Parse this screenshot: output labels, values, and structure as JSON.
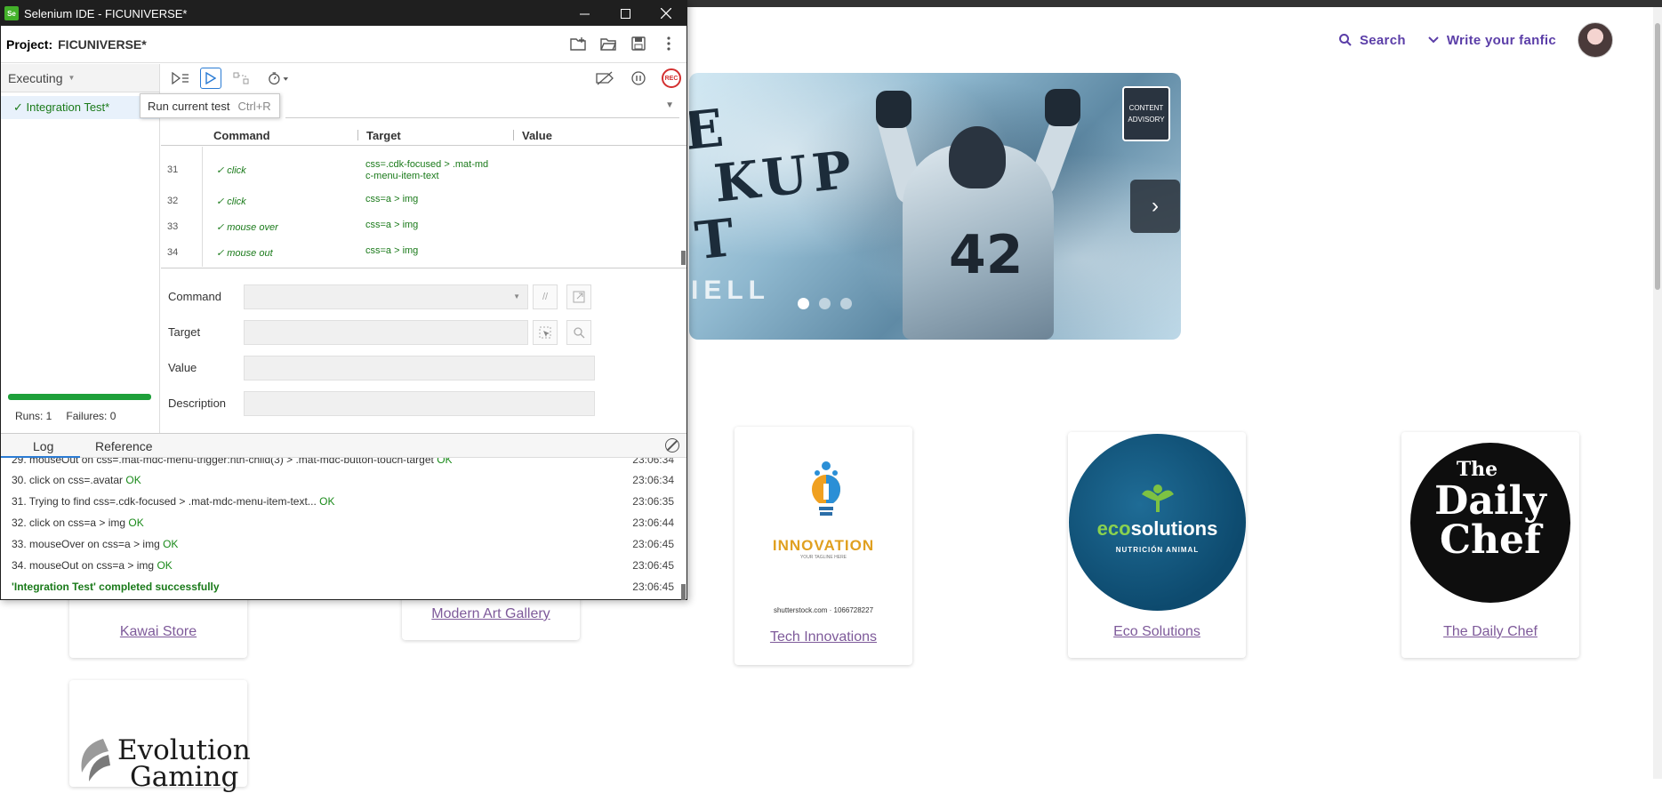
{
  "site": {
    "nav": {
      "search_label": "Search",
      "write_label": "Write your fanfic"
    },
    "carousel": {
      "title_lines": [
        "E",
        "KUP",
        "T"
      ],
      "bottom_text": "IELL",
      "jersey_number": "42",
      "advisory_line1": "CONTENT",
      "advisory_line2": "ADVISORY",
      "next_icon": "chevron-right-icon"
    },
    "cards": [
      {
        "label": "Kawai Store"
      },
      {
        "label": "Modern Art Gallery"
      },
      {
        "label": "Tech Innovations",
        "logo_text": "INNOVATION",
        "logo_tagline": "YOUR TAGLINE HERE",
        "credit": "shutterstock.com · 1066728227"
      },
      {
        "label": "Eco Solutions",
        "logo_text_a": "eco",
        "logo_text_b": "solutions",
        "logo_sub": "NUTRICIÓN ANIMAL"
      },
      {
        "label": "The Daily Chef",
        "logo_line1": "The",
        "logo_line2": "Daily",
        "logo_line3": "Chef"
      },
      {
        "logo_text_1": "Evolution",
        "logo_text_2": "Gaming"
      }
    ]
  },
  "ide": {
    "window_title": "Selenium IDE - FICUNIVERSE*",
    "logo_text": "Se",
    "project_label": "Project:",
    "project_name": "FICUNIVERSE*",
    "executing_label": "Executing",
    "test_name": "✓ Integration Test*",
    "tooltip": {
      "text": "Run current test",
      "shortcut": "Ctrl+R"
    },
    "table_headers": {
      "command": "Command",
      "target": "Target",
      "value": "Value"
    },
    "commands": [
      {
        "num": "31",
        "command": "✓ click",
        "target_l1": "css=.cdk-focused > .mat-md",
        "target_l2": "c-menu-item-text"
      },
      {
        "num": "32",
        "command": "✓ click",
        "target_l1": "css=a > img",
        "target_l2": ""
      },
      {
        "num": "33",
        "command": "✓ mouse over",
        "target_l1": "css=a > img",
        "target_l2": ""
      },
      {
        "num": "34",
        "command": "✓ mouse out",
        "target_l1": "css=a > img",
        "target_l2": ""
      }
    ],
    "editor": {
      "command_label": "Command",
      "target_label": "Target",
      "value_label": "Value",
      "description_label": "Description",
      "comment_btn": "//"
    },
    "stats": {
      "runs": "Runs: 1",
      "failures": "Failures: 0"
    },
    "log_tabs": {
      "log": "Log",
      "reference": "Reference"
    },
    "log": [
      {
        "text": "29. mouseOut on css=.mat-mdc-menu-trigger:nth-child(3) > .mat-mdc-button-touch-target",
        "ok": "OK",
        "time": "23:06:34"
      },
      {
        "text": "30. click on css=.avatar",
        "ok": "OK",
        "time": "23:06:34"
      },
      {
        "text": "31. Trying to find css=.cdk-focused > .mat-mdc-menu-item-text...",
        "ok": "OK",
        "time": "23:06:35"
      },
      {
        "text": "32. click on css=a > img",
        "ok": "OK",
        "time": "23:06:44"
      },
      {
        "text": "33. mouseOver on css=a > img",
        "ok": "OK",
        "time": "23:06:45"
      },
      {
        "text": "34. mouseOut on css=a > img",
        "ok": "OK",
        "time": "23:06:45"
      },
      {
        "text": "'Integration Test' completed successfully",
        "ok": "",
        "time": "23:06:45"
      }
    ]
  }
}
